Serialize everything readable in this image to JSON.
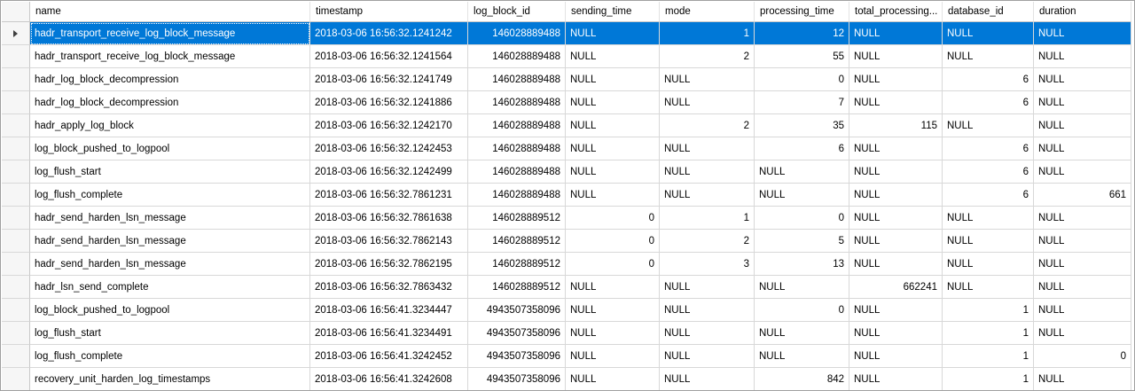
{
  "columns": [
    "name",
    "timestamp",
    "log_block_id",
    "sending_time",
    "mode",
    "processing_time",
    "total_processing...",
    "database_id",
    "duration"
  ],
  "align": [
    "l",
    "l",
    "r",
    "r",
    "r",
    "r",
    "r",
    "r",
    "r"
  ],
  "rows": [
    [
      "hadr_transport_receive_log_block_message",
      "2018-03-06 16:56:32.1241242",
      "146028889488",
      "NULL",
      "1",
      "12",
      "NULL",
      "NULL",
      "NULL"
    ],
    [
      "hadr_transport_receive_log_block_message",
      "2018-03-06 16:56:32.1241564",
      "146028889488",
      "NULL",
      "2",
      "55",
      "NULL",
      "NULL",
      "NULL"
    ],
    [
      "hadr_log_block_decompression",
      "2018-03-06 16:56:32.1241749",
      "146028889488",
      "NULL",
      "NULL",
      "0",
      "NULL",
      "6",
      "NULL"
    ],
    [
      "hadr_log_block_decompression",
      "2018-03-06 16:56:32.1241886",
      "146028889488",
      "NULL",
      "NULL",
      "7",
      "NULL",
      "6",
      "NULL"
    ],
    [
      "hadr_apply_log_block",
      "2018-03-06 16:56:32.1242170",
      "146028889488",
      "NULL",
      "2",
      "35",
      "115",
      "NULL",
      "NULL"
    ],
    [
      "log_block_pushed_to_logpool",
      "2018-03-06 16:56:32.1242453",
      "146028889488",
      "NULL",
      "NULL",
      "6",
      "NULL",
      "6",
      "NULL"
    ],
    [
      "log_flush_start",
      "2018-03-06 16:56:32.1242499",
      "146028889488",
      "NULL",
      "NULL",
      "NULL",
      "NULL",
      "6",
      "NULL"
    ],
    [
      "log_flush_complete",
      "2018-03-06 16:56:32.7861231",
      "146028889488",
      "NULL",
      "NULL",
      "NULL",
      "NULL",
      "6",
      "661"
    ],
    [
      "hadr_send_harden_lsn_message",
      "2018-03-06 16:56:32.7861638",
      "146028889512",
      "0",
      "1",
      "0",
      "NULL",
      "NULL",
      "NULL"
    ],
    [
      "hadr_send_harden_lsn_message",
      "2018-03-06 16:56:32.7862143",
      "146028889512",
      "0",
      "2",
      "5",
      "NULL",
      "NULL",
      "NULL"
    ],
    [
      "hadr_send_harden_lsn_message",
      "2018-03-06 16:56:32.7862195",
      "146028889512",
      "0",
      "3",
      "13",
      "NULL",
      "NULL",
      "NULL"
    ],
    [
      "hadr_lsn_send_complete",
      "2018-03-06 16:56:32.7863432",
      "146028889512",
      "NULL",
      "NULL",
      "NULL",
      "662241",
      "NULL",
      "NULL"
    ],
    [
      "log_block_pushed_to_logpool",
      "2018-03-06 16:56:41.3234447",
      "4943507358096",
      "NULL",
      "NULL",
      "0",
      "NULL",
      "1",
      "NULL"
    ],
    [
      "log_flush_start",
      "2018-03-06 16:56:41.3234491",
      "4943507358096",
      "NULL",
      "NULL",
      "NULL",
      "NULL",
      "1",
      "NULL"
    ],
    [
      "log_flush_complete",
      "2018-03-06 16:56:41.3242452",
      "4943507358096",
      "NULL",
      "NULL",
      "NULL",
      "NULL",
      "1",
      "0"
    ],
    [
      "recovery_unit_harden_log_timestamps",
      "2018-03-06 16:56:41.3242608",
      "4943507358096",
      "NULL",
      "NULL",
      "842",
      "NULL",
      "1",
      "NULL"
    ]
  ],
  "selected_row": 0,
  "colors": {
    "selection": "#0078d7",
    "grid_line": "#d8d8d8"
  }
}
